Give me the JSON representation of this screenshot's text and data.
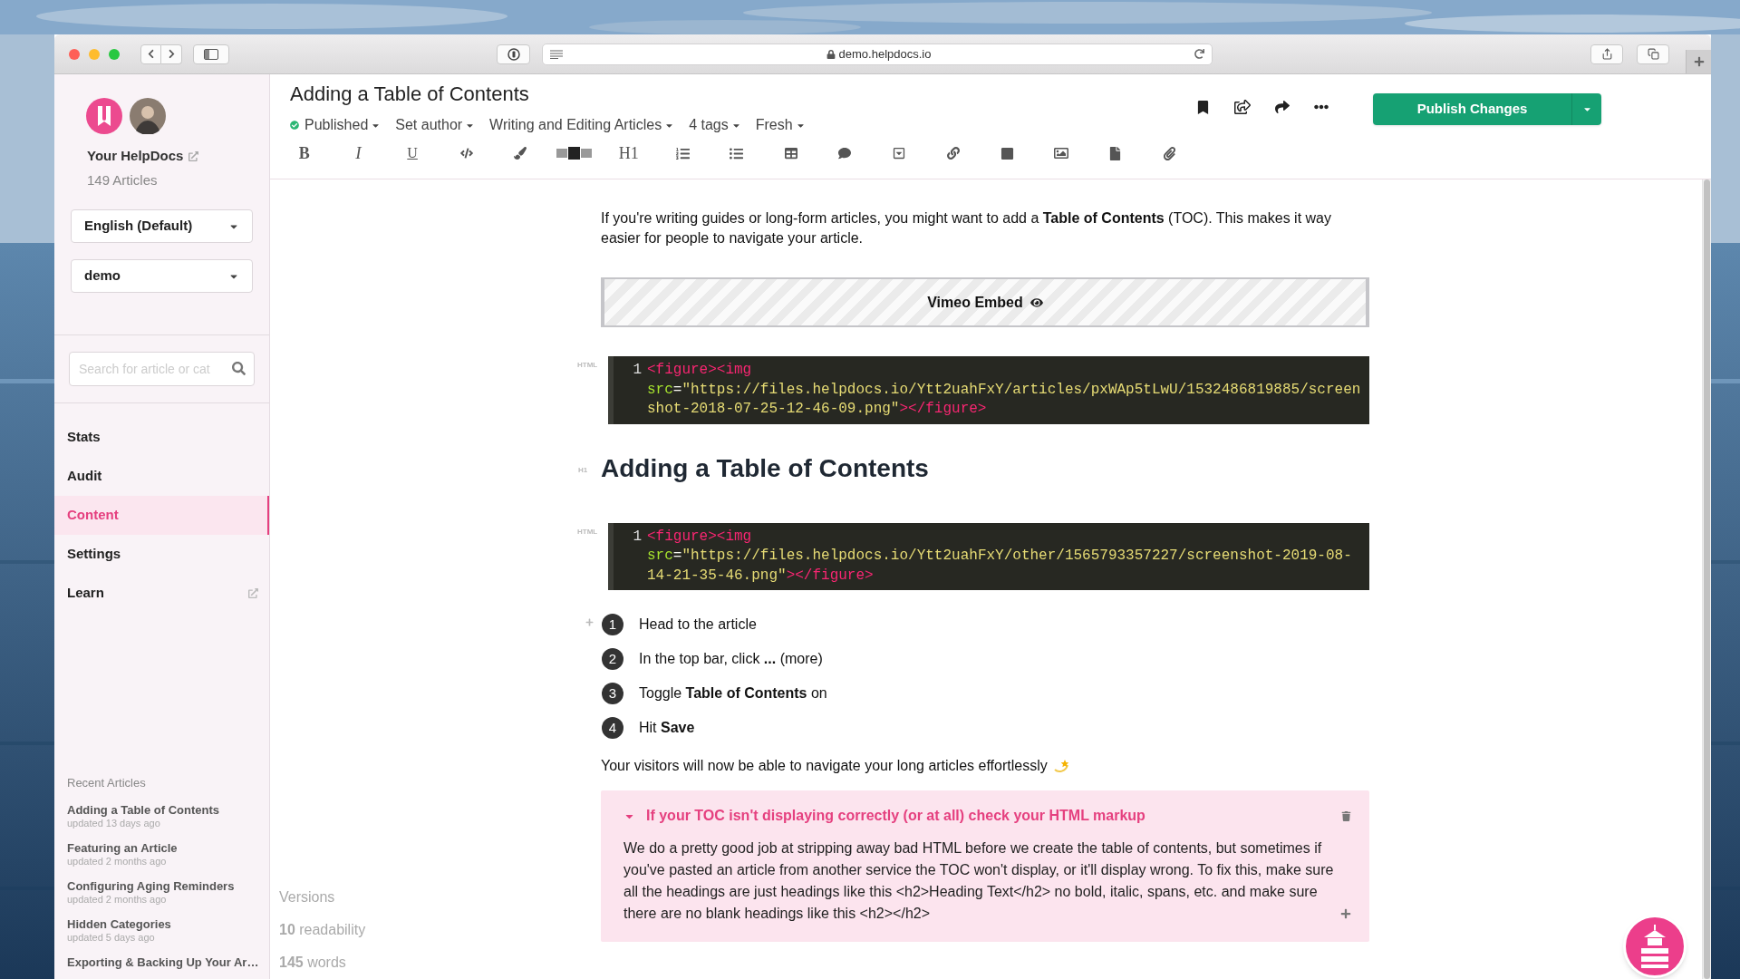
{
  "browser": {
    "url": "demo.helpdocs.io"
  },
  "sidebar": {
    "site_name": "Your HelpDocs",
    "article_count": "149 Articles",
    "language": "English (Default)",
    "project": "demo",
    "search": {
      "placeholder": "Search for article or cat"
    },
    "nav": [
      {
        "label": "Stats",
        "selected": false,
        "external": false
      },
      {
        "label": "Audit",
        "selected": false,
        "external": false
      },
      {
        "label": "Content",
        "selected": true,
        "external": false
      },
      {
        "label": "Settings",
        "selected": false,
        "external": false
      },
      {
        "label": "Learn",
        "selected": false,
        "external": true
      }
    ],
    "recent": {
      "title": "Recent Articles",
      "items": [
        {
          "title": "Adding a Table of Contents",
          "updated": "updated 13 days ago"
        },
        {
          "title": "Featuring an Article",
          "updated": "updated 2 months ago"
        },
        {
          "title": "Configuring Aging Reminders",
          "updated": "updated 2 months ago"
        },
        {
          "title": "Hidden Categories",
          "updated": "updated 5 days ago"
        },
        {
          "title": "Exporting & Backing Up Your Ar…"
        }
      ]
    }
  },
  "article": {
    "title": "Adding a Table of Contents",
    "meta": [
      {
        "label": "Published",
        "kind": "status"
      },
      {
        "label": "Set author",
        "kind": "menu"
      },
      {
        "label": "Writing and Editing Articles",
        "kind": "menu"
      },
      {
        "label": "4 tags",
        "kind": "menu"
      },
      {
        "label": "Fresh",
        "kind": "menu"
      }
    ],
    "publish_button": "Publish Changes"
  },
  "toolbar": {
    "bold": "B",
    "italic": "I",
    "underline": "U",
    "heading": "H1"
  },
  "blocks": [
    {
      "kind": "paragraph",
      "text": "If you're writing guides or long-form articles, you might want to add a **Table of Contents** (TOC). This makes it way easier for people to navigate your article.",
      "emoji": false
    },
    {
      "kind": "embed",
      "label": "Vimeo Embed"
    },
    {
      "kind": "code",
      "gutter": "HTML",
      "line": "1",
      "tokens": [
        {
          "text": "<figure><img ",
          "kind": "tag"
        },
        {
          "text": "src",
          "kind": "attr"
        },
        {
          "text": "=",
          "kind": "plain"
        },
        {
          "text": "\"https://files.helpdocs.io/Ytt2uahFxY/articles/pxWAp5tLwU/1532486819885/screenshot-2018-07-25-12-46-09.png\"",
          "kind": "string"
        },
        {
          "text": "></figure>",
          "kind": "tag"
        }
      ]
    },
    {
      "kind": "heading",
      "gutter": "H1",
      "text": "Adding a Table of Contents"
    },
    {
      "kind": "code",
      "gutter": "HTML",
      "line": "1",
      "tokens": [
        {
          "text": "<figure><img ",
          "kind": "tag"
        },
        {
          "text": "src",
          "kind": "attr"
        },
        {
          "text": "=",
          "kind": "plain"
        },
        {
          "text": "\"https://files.helpdocs.io/Ytt2uahFxY/other/1565793357227/screenshot-2019-08-14-21-35-46.png\"",
          "kind": "string"
        },
        {
          "text": "></figure>",
          "kind": "tag"
        }
      ]
    },
    {
      "kind": "steps",
      "items": [
        {
          "number": "1",
          "text": "Head to the article"
        },
        {
          "number": "2",
          "text": "In the top bar, click **...** (more)"
        },
        {
          "number": "3",
          "text": "Toggle **Table of Contents** on"
        },
        {
          "number": "4",
          "text": "Hit **Save**"
        }
      ]
    },
    {
      "kind": "paragraph",
      "text": "Your visitors will now be able to navigate your long articles effortlessly",
      "emoji": true
    },
    {
      "kind": "callout",
      "title": "If your TOC isn't displaying correctly (or at all) check your HTML markup",
      "expanded": true,
      "body": "We do a pretty good job at stripping away bad HTML before we create the table of contents, but sometimes if you've pasted an article from another service the TOC won't display, or it'll display wrong. To fix this, make sure all the headings are just headings like this <h2>Heading Text</h2> no bold, italic, spans, etc. and make sure there are no blank headings like this <h2></h2>"
    }
  ],
  "stats": {
    "versions": "Versions",
    "readability": "**10** readability",
    "words": "**145** words"
  }
}
